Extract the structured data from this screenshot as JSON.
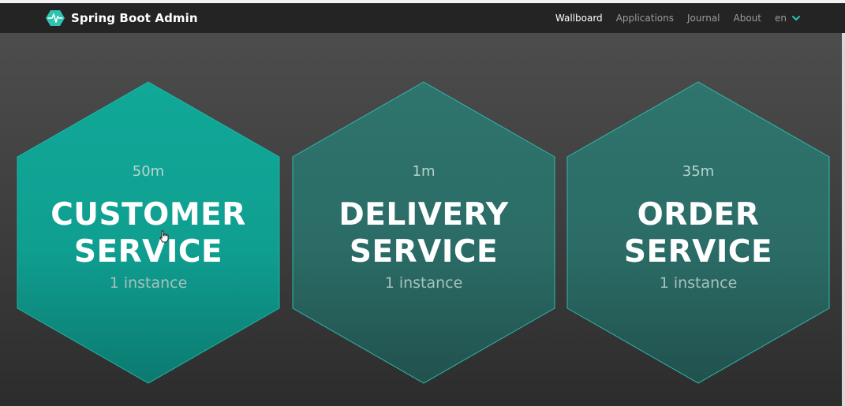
{
  "navbar": {
    "brand_title": "Spring Boot Admin",
    "brand_icon": "heartbeat-hexagon-icon",
    "links": [
      {
        "label": "Wallboard",
        "active": true
      },
      {
        "label": "Applications",
        "active": false
      },
      {
        "label": "Journal",
        "active": false
      },
      {
        "label": "About",
        "active": false
      }
    ],
    "language": "en"
  },
  "wallboard": {
    "applications": [
      {
        "time": "50m",
        "name": "CUSTOMER SERVICE",
        "instances": "1 instance",
        "status": "UP",
        "highlighted": true
      },
      {
        "time": "1m",
        "name": "DELIVERY SERVICE",
        "instances": "1 instance",
        "status": "UP",
        "highlighted": false
      },
      {
        "time": "35m",
        "name": "ORDER SERVICE",
        "instances": "1 instance",
        "status": "UP",
        "highlighted": false
      }
    ]
  },
  "colors": {
    "accent": "#42d3a5",
    "hex_highlight": "#0fa597",
    "hex_normal": "#2b6f68",
    "hex_border": "#2eb8ad",
    "navbar_bg": "#242424"
  }
}
